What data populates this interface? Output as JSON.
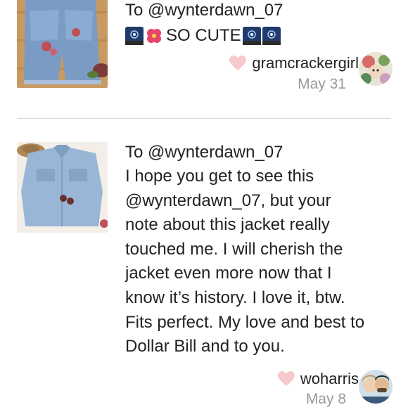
{
  "notes": [
    {
      "to_line": "To @wynterdawn_07",
      "message_parts": [
        "SO CUTE"
      ],
      "emojis": [
        "fireworks-icon",
        "hibiscus-icon",
        "fireworks-icon",
        "fireworks-icon"
      ],
      "username": "gramcrackergirl",
      "date": "May 31",
      "liked": true
    },
    {
      "to_line": "To @wynterdawn_07",
      "message_lines": [
        "I hope you get to see this",
        "@wynterdawn_07, but your",
        "note about this jacket really",
        "touched me. I will cherish the",
        "jacket even more now that I",
        "know it’s history. I love it, btw.",
        "Fits perfect. My love and best to",
        "Dollar Bill and to you."
      ],
      "username": "woharris",
      "date": "May 8",
      "liked": true
    }
  ],
  "colors": {
    "heart": "#f7c8cc",
    "date": "#9a9a9a",
    "divider": "#d9d9d9",
    "text": "#222222"
  }
}
